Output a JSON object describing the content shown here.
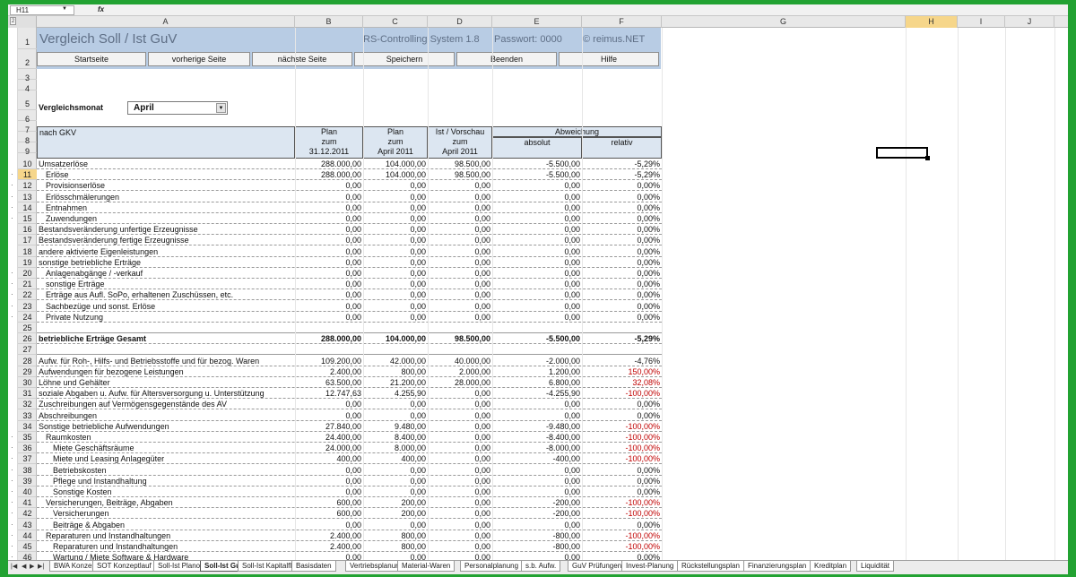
{
  "formula_bar": {
    "name_box": "H11",
    "fx": "fx"
  },
  "outline_level": "2",
  "columns": [
    "A",
    "B",
    "C",
    "D",
    "E",
    "F",
    "G",
    "H",
    "I",
    "J"
  ],
  "title": {
    "main": "Vergleich Soll / Ist GuV",
    "system": "RS-Controlling System 1.8",
    "password": "Passwort: 0000",
    "copyright": "© reimus.NET"
  },
  "buttons": [
    "Startseite",
    "vorherige Seite",
    "nächste Seite",
    "Speichern",
    "Beenden",
    "Hilfe"
  ],
  "vergleichsmonat": {
    "label": "Vergleichsmonat",
    "value": "April"
  },
  "header": {
    "col_a": "nach GKV",
    "plan1": [
      "Plan",
      "zum",
      "31.12.2011"
    ],
    "plan2": [
      "Plan",
      "zum",
      "April 2011"
    ],
    "ist": [
      "Ist / Vorschau",
      "zum",
      "April 2011"
    ],
    "abw": "Abweichung",
    "absolut": "absolut",
    "relativ": "relativ"
  },
  "rows": [
    {
      "n": "10",
      "label": "Umsatzerlöse",
      "b": "288.000,00",
      "c": "104.000,00",
      "d": "98.500,00",
      "e": "-5.500,00",
      "f": "-5,29%"
    },
    {
      "n": "11",
      "label": "Erlöse",
      "indent": 1,
      "b": "288.000,00",
      "c": "104.000,00",
      "d": "98.500,00",
      "e": "-5.500,00",
      "f": "-5,29%"
    },
    {
      "n": "12",
      "label": "Provisionserlöse",
      "indent": 1,
      "b": "0,00",
      "c": "0,00",
      "d": "0,00",
      "e": "0,00",
      "f": "0,00%"
    },
    {
      "n": "13",
      "label": "Erlösschmälerungen",
      "indent": 1,
      "b": "0,00",
      "c": "0,00",
      "d": "0,00",
      "e": "0,00",
      "f": "0,00%"
    },
    {
      "n": "14",
      "label": "Entnahmen",
      "indent": 1,
      "b": "0,00",
      "c": "0,00",
      "d": "0,00",
      "e": "0,00",
      "f": "0,00%"
    },
    {
      "n": "15",
      "label": "Zuwendungen",
      "indent": 1,
      "b": "0,00",
      "c": "0,00",
      "d": "0,00",
      "e": "0,00",
      "f": "0,00%"
    },
    {
      "n": "16",
      "label": "Bestandsveränderung unfertige Erzeugnisse",
      "b": "0,00",
      "c": "0,00",
      "d": "0,00",
      "e": "0,00",
      "f": "0,00%"
    },
    {
      "n": "17",
      "label": "Bestandsveränderung fertige Erzeugnisse",
      "b": "0,00",
      "c": "0,00",
      "d": "0,00",
      "e": "0,00",
      "f": "0,00%"
    },
    {
      "n": "18",
      "label": "andere aktivierte Eigenleistungen",
      "b": "0,00",
      "c": "0,00",
      "d": "0,00",
      "e": "0,00",
      "f": "0,00%"
    },
    {
      "n": "19",
      "label": "sonstige betriebliche Erträge",
      "b": "0,00",
      "c": "0,00",
      "d": "0,00",
      "e": "0,00",
      "f": "0,00%"
    },
    {
      "n": "20",
      "label": "Anlagenabgänge / -verkauf",
      "indent": 1,
      "b": "0,00",
      "c": "0,00",
      "d": "0,00",
      "e": "0,00",
      "f": "0,00%"
    },
    {
      "n": "21",
      "label": "sonstige Erträge",
      "indent": 1,
      "b": "0,00",
      "c": "0,00",
      "d": "0,00",
      "e": "0,00",
      "f": "0,00%"
    },
    {
      "n": "22",
      "label": "Erträge aus Aufl. SoPo, erhaltenen Zuschüssen, etc.",
      "indent": 1,
      "b": "0,00",
      "c": "0,00",
      "d": "0,00",
      "e": "0,00",
      "f": "0,00%"
    },
    {
      "n": "23",
      "label": "Sachbezüge und sonst. Erlöse",
      "indent": 1,
      "b": "0,00",
      "c": "0,00",
      "d": "0,00",
      "e": "0,00",
      "f": "0,00%"
    },
    {
      "n": "24",
      "label": "Private Nutzung",
      "indent": 1,
      "b": "0,00",
      "c": "0,00",
      "d": "0,00",
      "e": "0,00",
      "f": "0,00%"
    },
    {
      "n": "25",
      "label": "",
      "blank": true
    },
    {
      "n": "26",
      "label": "betriebliche Erträge Gesamt",
      "bold": true,
      "b": "288.000,00",
      "c": "104.000,00",
      "d": "98.500,00",
      "e": "-5.500,00",
      "f": "-5,29%"
    },
    {
      "n": "27",
      "label": "",
      "blank": true
    },
    {
      "n": "28",
      "label": "Aufw. für Roh-, Hilfs- und Betriebsstoffe und für bezog. Waren",
      "b": "109.200,00",
      "c": "42.000,00",
      "d": "40.000,00",
      "e": "-2.000,00",
      "f": "-4,76%"
    },
    {
      "n": "29",
      "label": "Aufwendungen für bezogene Leistungen",
      "b": "2.400,00",
      "c": "800,00",
      "d": "2.000,00",
      "e": "1.200,00",
      "f": "150,00%",
      "red": true
    },
    {
      "n": "30",
      "label": "Löhne und Gehälter",
      "b": "63.500,00",
      "c": "21.200,00",
      "d": "28.000,00",
      "e": "6.800,00",
      "f": "32,08%",
      "red": true
    },
    {
      "n": "31",
      "label": "soziale Abgaben u. Aufw. für Altersversorgung u. Unterstützung",
      "b": "12.747,63",
      "c": "4.255,90",
      "d": "0,00",
      "e": "-4.255,90",
      "f": "-100,00%",
      "red": true
    },
    {
      "n": "32",
      "label": "Zuschreibungen auf Vermögensgegenstände des AV",
      "b": "0,00",
      "c": "0,00",
      "d": "0,00",
      "e": "0,00",
      "f": "0,00%"
    },
    {
      "n": "33",
      "label": "Abschreibungen",
      "b": "0,00",
      "c": "0,00",
      "d": "0,00",
      "e": "0,00",
      "f": "0,00%"
    },
    {
      "n": "34",
      "label": "Sonstige betriebliche Aufwendungen",
      "b": "27.840,00",
      "c": "9.480,00",
      "d": "0,00",
      "e": "-9.480,00",
      "f": "-100,00%",
      "red": true
    },
    {
      "n": "35",
      "label": "Raumkosten",
      "indent": 1,
      "b": "24.400,00",
      "c": "8.400,00",
      "d": "0,00",
      "e": "-8.400,00",
      "f": "-100,00%",
      "red": true
    },
    {
      "n": "36",
      "label": "Miete Geschäftsräume",
      "indent": 2,
      "b": "24.000,00",
      "c": "8.000,00",
      "d": "0,00",
      "e": "-8.000,00",
      "f": "-100,00%",
      "red": true
    },
    {
      "n": "37",
      "label": "Miete und Leasing Anlagegüter",
      "indent": 2,
      "b": "400,00",
      "c": "400,00",
      "d": "0,00",
      "e": "-400,00",
      "f": "-100,00%",
      "red": true
    },
    {
      "n": "38",
      "label": "Betriebskosten",
      "indent": 2,
      "b": "0,00",
      "c": "0,00",
      "d": "0,00",
      "e": "0,00",
      "f": "0,00%"
    },
    {
      "n": "39",
      "label": "Pflege und Instandhaltung",
      "indent": 2,
      "b": "0,00",
      "c": "0,00",
      "d": "0,00",
      "e": "0,00",
      "f": "0,00%"
    },
    {
      "n": "40",
      "label": "Sonstige Kosten",
      "indent": 2,
      "b": "0,00",
      "c": "0,00",
      "d": "0,00",
      "e": "0,00",
      "f": "0,00%"
    },
    {
      "n": "41",
      "label": "Versicherungen, Beiträge, Abgaben",
      "indent": 1,
      "b": "600,00",
      "c": "200,00",
      "d": "0,00",
      "e": "-200,00",
      "f": "-100,00%",
      "red": true
    },
    {
      "n": "42",
      "label": "Versicherungen",
      "indent": 2,
      "b": "600,00",
      "c": "200,00",
      "d": "0,00",
      "e": "-200,00",
      "f": "-100,00%",
      "red": true
    },
    {
      "n": "43",
      "label": "Beiträge & Abgaben",
      "indent": 2,
      "b": "0,00",
      "c": "0,00",
      "d": "0,00",
      "e": "0,00",
      "f": "0,00%"
    },
    {
      "n": "44",
      "label": "Reparaturen und Instandhaltungen",
      "indent": 1,
      "b": "2.400,00",
      "c": "800,00",
      "d": "0,00",
      "e": "-800,00",
      "f": "-100,00%",
      "red": true
    },
    {
      "n": "45",
      "label": "Reparaturen und Instandhaltungen",
      "indent": 2,
      "b": "2.400,00",
      "c": "800,00",
      "d": "0,00",
      "e": "-800,00",
      "f": "-100,00%",
      "red": true
    },
    {
      "n": "46",
      "label": "Wartung / Miete Software & Hardware",
      "indent": 2,
      "b": "0,00",
      "c": "0,00",
      "d": "0,00",
      "e": "0,00",
      "f": "0,00%"
    }
  ],
  "sheet_tabs": [
    "BWA Konzept",
    "SOT Konzeptlauf",
    "Soll-Ist Plano",
    "Soll-Ist GuV",
    "Soll-Ist Kapitalfluss",
    "Basisdaten",
    "Vertriebsplanung",
    "Material-Waren",
    "Personalplanung",
    "s.b. Aufw.",
    "GuV Prüfungen",
    "Invest-Planung",
    "Rückstellungsplan",
    "Finanzierungsplan",
    "Kreditplan",
    "Liquidität"
  ],
  "active_tab": "Soll-Ist GuV",
  "gutter_marks": [
    "11",
    "12",
    "13",
    "14",
    "15",
    "20",
    "21",
    "22",
    "23",
    "24",
    "35",
    "36",
    "37",
    "38",
    "39",
    "40",
    "41",
    "42",
    "43",
    "44",
    "45",
    "46"
  ],
  "selected_row": "11",
  "selected_col": "H"
}
